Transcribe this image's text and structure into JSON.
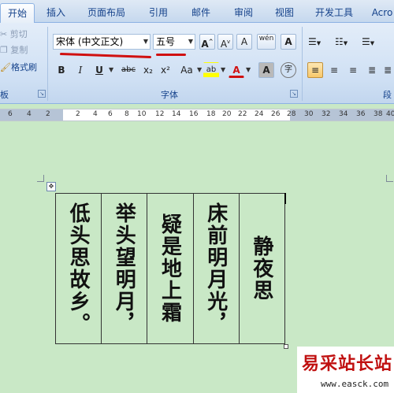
{
  "tabs": [
    "开始",
    "插入",
    "页面布局",
    "引用",
    "邮件",
    "审阅",
    "视图",
    "开发工具",
    "Acro"
  ],
  "clipboard": {
    "cut": "剪切",
    "copy": "复制",
    "format_painter": "格式刷",
    "label": "板"
  },
  "font": {
    "name": "宋体 (中文正文)",
    "size": "五号",
    "grow": "A",
    "shrink": "A",
    "clear": "A",
    "phonetic": "wén",
    "border_char": "A",
    "bold": "B",
    "italic": "I",
    "underline": "U",
    "strike": "abc",
    "subscript": "x₂",
    "superscript": "x²",
    "case": "Aa",
    "highlight": "ab",
    "color": "A",
    "shade": "A",
    "enclose": "字",
    "label": "字体"
  },
  "paragraph": {
    "label": "段"
  },
  "ruler": [
    "6",
    "4",
    "2",
    "2",
    "4",
    "6",
    "8",
    "10",
    "12",
    "14",
    "16",
    "18",
    "20",
    "22",
    "24",
    "26",
    "28",
    "30",
    "32",
    "34",
    "36",
    "38",
    "40"
  ],
  "poem": {
    "columns": [
      "低头思故乡。",
      "举头望明月，",
      "疑是地上霜",
      "床前明月光，",
      "静夜思"
    ]
  },
  "watermark": {
    "title": "易采站长站",
    "url": "www.easck.com"
  },
  "colors": {
    "accent": "#d01010",
    "page": "#c9e8c6",
    "ribbon": "#cfe0f4"
  }
}
